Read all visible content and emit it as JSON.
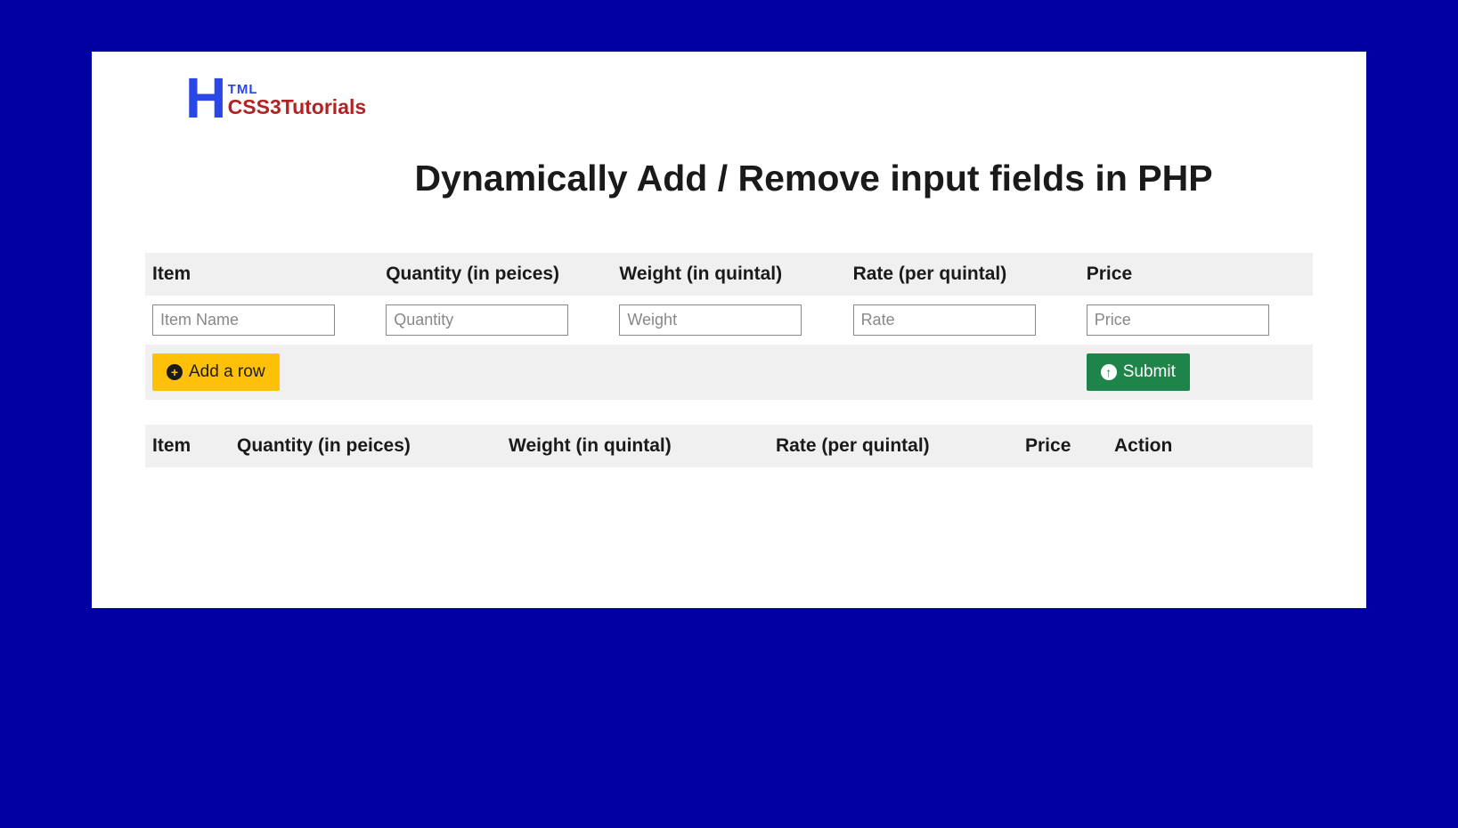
{
  "logo": {
    "h": "H",
    "tml": "TML",
    "sub": "CSS3Tutorials"
  },
  "title": "Dynamically Add / Remove input fields in PHP",
  "form": {
    "headers": {
      "item": "Item",
      "quantity": "Quantity (in peices)",
      "weight": "Weight (in quintal)",
      "rate": "Rate (per quintal)",
      "price": "Price"
    },
    "placeholders": {
      "item": "Item Name",
      "quantity": "Quantity",
      "weight": "Weight",
      "rate": "Rate",
      "price": "Price"
    },
    "buttons": {
      "add_row": "Add a row",
      "submit": "Submit"
    }
  },
  "results": {
    "headers": {
      "item": "Item",
      "quantity": "Quantity (in peices)",
      "weight": "Weight (in quintal)",
      "rate": "Rate (per quintal)",
      "price": "Price",
      "action": "Action"
    }
  }
}
